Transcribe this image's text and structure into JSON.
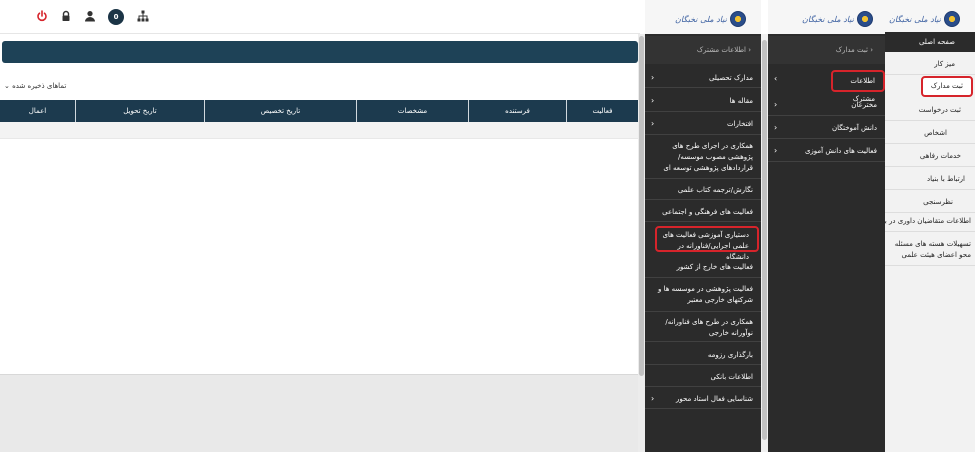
{
  "topbar": {
    "badge_count": "0"
  },
  "main": {
    "saved_label": "تماهای ذخیره شده",
    "table_headers": [
      "فعالیت",
      "فرستنده",
      "مشخصات",
      "تاریخ تخصیص",
      "تاریخ تحویل",
      "اعمال"
    ]
  },
  "logo": {
    "text": "نیاد ملی نخبگان"
  },
  "col1": {
    "header": "اطلاعات مشترک",
    "items": [
      "مدارک تحصیلی",
      "مقاله ها",
      "افتخارات",
      "همکاری در اجرای طرح های پژوهشی مصوب موسسه/قراردادهای پژوهشی توسعه ای",
      "نگارش/ترجمه کتاب علمی",
      "فعالیت های فرهنگی و اجتماعی",
      "دستیاری آموزشی فعالیت های علمی اجرایی/فناورانه در دانشگاه",
      "فعالیت های خارج از کشور",
      "فعالیت پژوهشی در موسسه ها و شرکتهای خارجی معتبر",
      "همکاری در طرح های فناورانه/نوآورانه خارجی",
      "بارگذاری رزومه",
      "اطلاعات بانکی",
      "شناسایی فعال استاد محور"
    ]
  },
  "col2": {
    "header": "ثبت مدارک",
    "items": [
      "اطلاعات مشترک",
      "مخترعان",
      "دانش آموختگان",
      "فعالیت های دانش آموزی"
    ]
  },
  "col3": {
    "items": [
      "صفحه اصلی",
      "میز کار",
      "ثبت مدارک",
      "ثبت درخواست",
      "اشخاص",
      "خدمات رفاهی",
      "ارتباط با بنیاد",
      "نظرسنجی",
      "اطلاعات متقاضیان داوری در بنیاد",
      "تسهیلات هسته های مسئله محو اعضای هیئت علمی"
    ]
  },
  "colors": {
    "dark_menu": "#2b2b2b",
    "header_blue": "#1c3a4e",
    "highlight": "#d6242b"
  }
}
